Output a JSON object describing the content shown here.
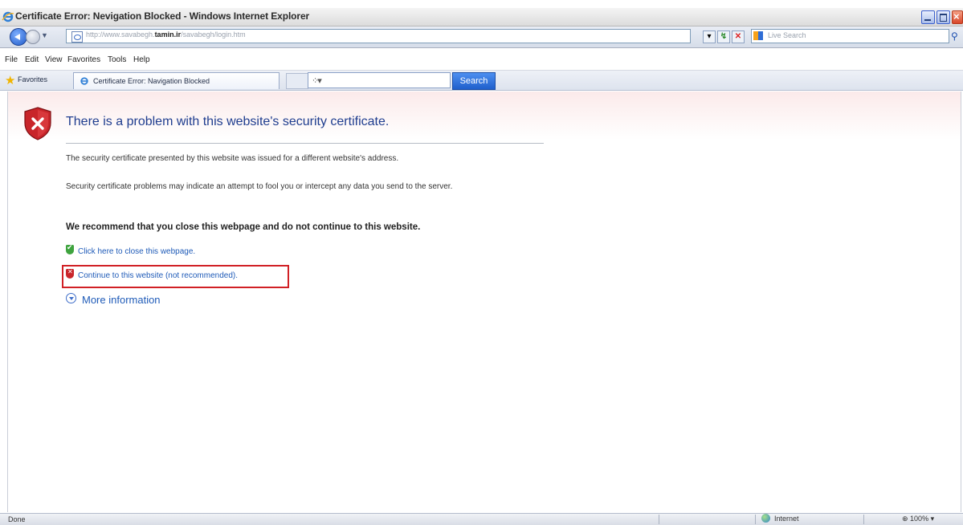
{
  "window": {
    "title": "Certificate Error: Nevigation Blocked - Windows Internet Explorer"
  },
  "address_bar": {
    "url_prefix": "http://www.savabegh.",
    "url_domain": "tamin.ir",
    "url_path": "/savabegh/login.htm",
    "search_placeholder": "Live Search"
  },
  "menu": {
    "items": [
      "File",
      "Edit",
      "View",
      "Favorites",
      "Tools",
      "Help"
    ]
  },
  "favorites_bar": {
    "favorites_label": "Favorites",
    "tab_title": "Certificate Error: Navigation Blocked",
    "search_button": "Search"
  },
  "page": {
    "heading": "There is a problem with this website's security certificate.",
    "paragraph1": "The security certificate presented by this website was issued for a different website's address.",
    "paragraph2": "Security certificate problems may indicate an attempt to fool you or intercept any data you send to the server.",
    "recommendation": "We recommend that you close this webpage and do not continue to this website.",
    "close_link": "Click here to close this webpage.",
    "continue_link": "Continue to this website (not recommended).",
    "more_info": "More information"
  },
  "status_bar": {
    "status": "Done",
    "zone": "Internet",
    "zoom": "100%"
  },
  "colors": {
    "link": "#1f5bb8",
    "heading": "#1f3d8f",
    "highlight_box": "#d12025"
  }
}
